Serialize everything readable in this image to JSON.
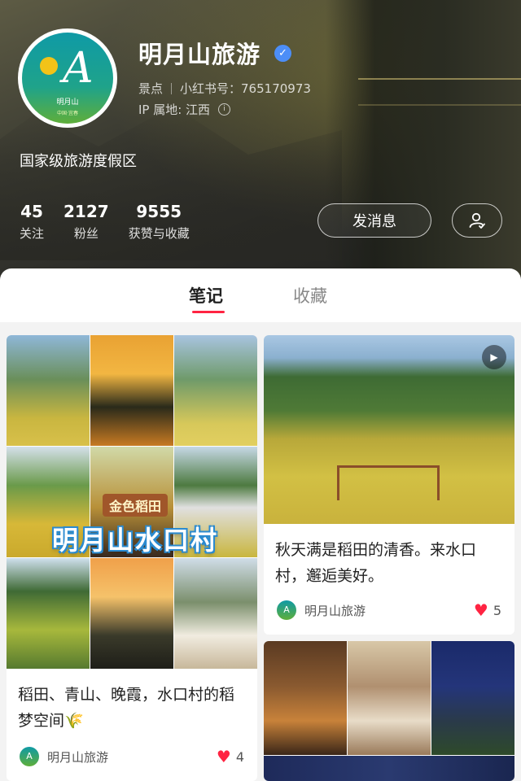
{
  "profile": {
    "name": "明月山旅游",
    "category": "景点",
    "xhs_id": "小红书号：765170973",
    "ip": "IP 属地: 江西",
    "bio": "国家级旅游度假区",
    "avatar_caption": "明月山",
    "avatar_sub": "中国·宜春"
  },
  "stats": [
    {
      "value": "45",
      "label": "关注"
    },
    {
      "value": "2127",
      "label": "粉丝"
    },
    {
      "value": "9555",
      "label": "获赞与收藏"
    }
  ],
  "actions": {
    "message": "发消息"
  },
  "tabs": {
    "notes": "笔记",
    "favorites": "收藏"
  },
  "posts": [
    {
      "title": "稻田、青山、晚霞，水口村的稻梦空间🌾",
      "author": "明月山旅游",
      "likes": "4",
      "overlay_sub": "金色稻田",
      "overlay_main": "明月山水口村"
    },
    {
      "title": "秋天满是稻田的清香。来水口村，邂逅美好。",
      "author": "明月山旅游",
      "likes": "5"
    }
  ],
  "colors": {
    "accent": "#ff2442",
    "verified": "#4c8ef7"
  },
  "icons": [
    "verified-icon",
    "info-icon",
    "add-friend-icon",
    "heart-icon",
    "play-icon"
  ]
}
